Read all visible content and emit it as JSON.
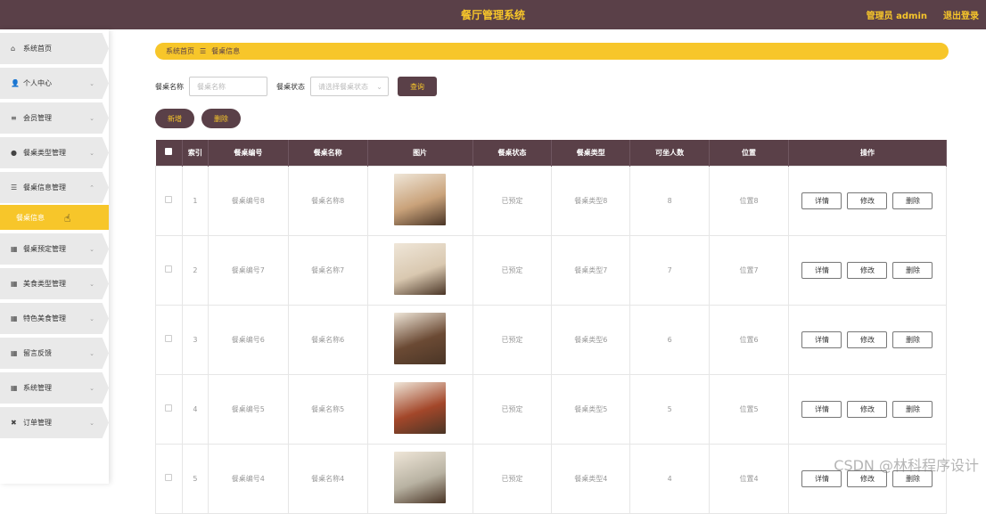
{
  "header": {
    "title": "餐厅管理系统",
    "user": "管理员 admin",
    "logout": "退出登录"
  },
  "sidebar": {
    "items": [
      {
        "icon": "home-icon",
        "glyph": "⌂",
        "label": "系统首页",
        "chev": ""
      },
      {
        "icon": "user-icon",
        "glyph": "👤",
        "label": "个人中心",
        "chev": "⌄"
      },
      {
        "icon": "list-icon",
        "glyph": "≡",
        "label": "会员管理",
        "chev": "⌄"
      },
      {
        "icon": "pin-icon",
        "glyph": "●",
        "label": "餐桌类型管理",
        "chev": "⌄"
      },
      {
        "icon": "sliders-icon",
        "glyph": "☰",
        "label": "餐桌信息管理",
        "chev": "⌃"
      }
    ],
    "active_sub": "餐桌信息",
    "items_after": [
      {
        "icon": "grid-icon",
        "glyph": "▦",
        "label": "餐桌预定管理",
        "chev": "⌄"
      },
      {
        "icon": "grid-icon",
        "glyph": "▦",
        "label": "美食类型管理",
        "chev": "⌄"
      },
      {
        "icon": "grid-icon",
        "glyph": "▦",
        "label": "特色美食管理",
        "chev": "⌄"
      },
      {
        "icon": "grid-icon",
        "glyph": "▦",
        "label": "留言反馈",
        "chev": "⌄"
      },
      {
        "icon": "grid-icon",
        "glyph": "▦",
        "label": "系统管理",
        "chev": "⌄"
      },
      {
        "icon": "ticket-icon",
        "glyph": "✖",
        "label": "订单管理",
        "chev": "⌄"
      }
    ]
  },
  "breadcrumb": {
    "home": "系统首页",
    "sep": "☰",
    "current": "餐桌信息"
  },
  "search": {
    "name_label": "餐桌名称",
    "name_placeholder": "餐桌名称",
    "status_label": "餐桌状态",
    "status_placeholder": "请选择餐桌状态",
    "query_button": "查询"
  },
  "actions": {
    "add": "新增",
    "delete": "删除"
  },
  "table": {
    "headers": [
      "索引",
      "餐桌编号",
      "餐桌名称",
      "图片",
      "餐桌状态",
      "餐桌类型",
      "可坐人数",
      "位置",
      "操作"
    ],
    "ops": {
      "detail": "详情",
      "edit": "修改",
      "delete": "删除"
    },
    "rows": [
      {
        "index": "1",
        "code": "餐桌编号8",
        "name": "餐桌名称8",
        "status": "已预定",
        "type": "餐桌类型8",
        "seats": "8",
        "loc": "位置8",
        "img": "#c9a27a"
      },
      {
        "index": "2",
        "code": "餐桌编号7",
        "name": "餐桌名称7",
        "status": "已预定",
        "type": "餐桌类型7",
        "seats": "7",
        "loc": "位置7",
        "img": "#d9c8b0"
      },
      {
        "index": "3",
        "code": "餐桌编号6",
        "name": "餐桌名称6",
        "status": "已预定",
        "type": "餐桌类型6",
        "seats": "6",
        "loc": "位置6",
        "img": "#6b4a34"
      },
      {
        "index": "4",
        "code": "餐桌编号5",
        "name": "餐桌名称5",
        "status": "已预定",
        "type": "餐桌类型5",
        "seats": "5",
        "loc": "位置5",
        "img": "#a3472a"
      },
      {
        "index": "5",
        "code": "餐桌编号4",
        "name": "餐桌名称4",
        "status": "已预定",
        "type": "餐桌类型4",
        "seats": "4",
        "loc": "位置4",
        "img": "#b8b2a2"
      }
    ]
  },
  "watermark": "CSDN @林科程序设计"
}
